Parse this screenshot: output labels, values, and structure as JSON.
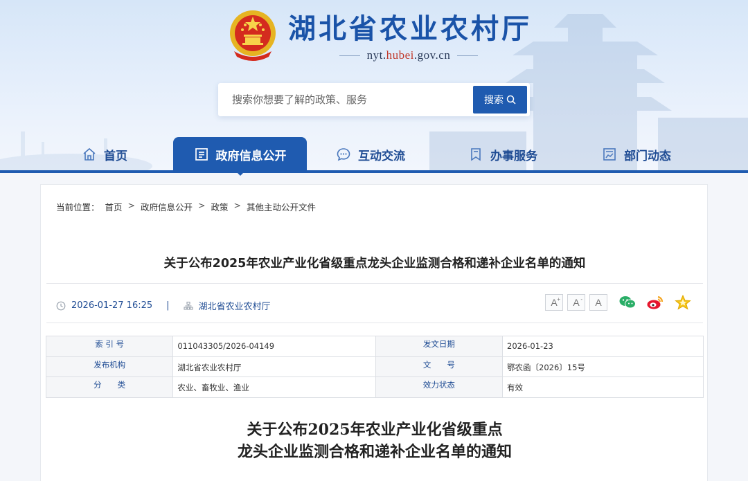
{
  "header": {
    "site_title": "湖北省农业农村厅",
    "site_url_prefix": "nyt.",
    "site_url_highlight": "hubei",
    "site_url_suffix": ".gov.cn",
    "search_placeholder": "搜索你想要了解的政策、服务",
    "search_button": "搜索"
  },
  "nav": {
    "items": [
      {
        "label": "首页",
        "icon": "home-icon"
      },
      {
        "label": "政府信息公开",
        "icon": "document-list-icon",
        "active": true
      },
      {
        "label": "互动交流",
        "icon": "chat-bubble-icon"
      },
      {
        "label": "办事服务",
        "icon": "bookmark-icon"
      },
      {
        "label": "部门动态",
        "icon": "news-chart-icon"
      }
    ]
  },
  "breadcrumb": {
    "prefix": "当前位置：",
    "items": [
      "首页",
      "政府信息公开",
      "政策",
      "其他主动公开文件"
    ],
    "separator": ">"
  },
  "article": {
    "title": "关于公布2025年农业产业化省级重点龙头企业监测合格和递补企业名单的通知",
    "datetime": "2026-01-27 16:25",
    "source": "湖北省农业农村厅",
    "font_sizes": [
      "A",
      "A",
      "A"
    ],
    "share": [
      "wechat-icon",
      "weibo-icon",
      "favorite-star-icon"
    ]
  },
  "info_table": {
    "rows": [
      {
        "k1": "索 引 号",
        "v1": "011043305/2026-04149",
        "k2": "发文日期",
        "v2": "2026-01-23"
      },
      {
        "k1": "发布机构",
        "v1": "湖北省农业农村厅",
        "k2": "文　　号",
        "v2": "鄂农函〔2026〕15号"
      },
      {
        "k1": "分　　类",
        "v1": "农业、畜牧业、渔业",
        "k2": "效力状态",
        "v2": "有效"
      }
    ]
  },
  "document": {
    "title_line1": "关于公布2025年农业产业化省级重点",
    "title_line2": "龙头企业监测合格和递补企业名单的通知"
  },
  "colors": {
    "primary": "#1f5bb0",
    "title_blue": "#1a53a8",
    "link_blue": "#1f4c94"
  }
}
